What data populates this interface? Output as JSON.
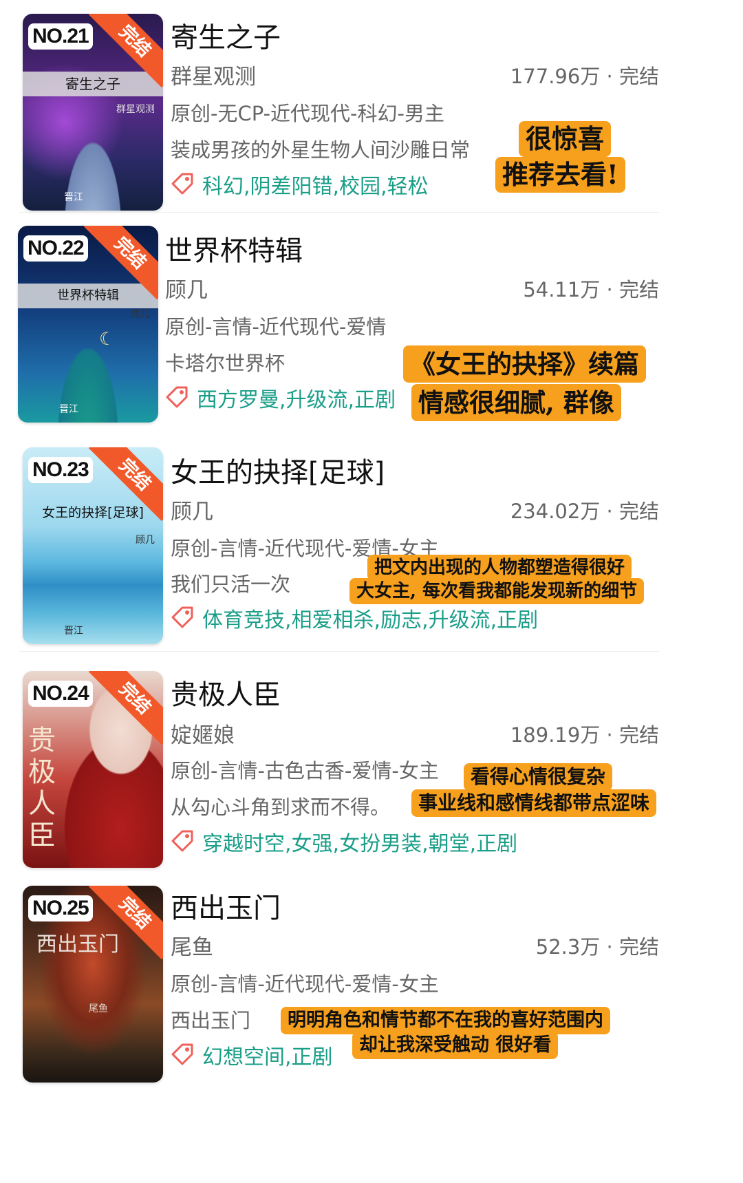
{
  "items": [
    {
      "rank": "NO.21",
      "status_ribbon": "完结",
      "cover_title": "寄生之子",
      "cover_author": "群星观测",
      "cover_logo": "晋江",
      "title": "寄生之子",
      "author": "群星观测",
      "stats": "177.96万 · 完结",
      "category": "原创-无CP-近代现代-科幻-男主",
      "summary": "装成男孩的外星生物人间沙雕日常",
      "tags": "科幻,阴差阳错,校园,轻松",
      "notes": [
        "很惊喜",
        "推荐去看!"
      ]
    },
    {
      "rank": "NO.22",
      "status_ribbon": "完结",
      "cover_title": "世界杯特辑",
      "cover_author": "顾几",
      "cover_logo": "晋江",
      "title": "世界杯特辑",
      "author": "顾几",
      "stats": "54.11万 · 完结",
      "category": "原创-言情-近代现代-爱情",
      "summary": "卡塔尔世界杯",
      "tags": "西方罗曼,升级流,正剧",
      "notes": [
        "《女王的抉择》续篇",
        "情感很细腻, 群像"
      ]
    },
    {
      "rank": "NO.23",
      "status_ribbon": "完结",
      "cover_title": "女王的抉择[足球]",
      "cover_author": "顾几",
      "cover_logo": "晋江",
      "title": "女王的抉择[足球]",
      "author": "顾几",
      "stats": "234.02万 · 完结",
      "category": "原创-言情-近代现代-爱情-女主",
      "summary": "我们只活一次",
      "tags": "体育竞技,相爱相杀,励志,升级流,正剧",
      "notes": [
        "把文内出现的人物都塑造得很好",
        "大女主, 每次看我都能发现新的细节"
      ]
    },
    {
      "rank": "NO.24",
      "status_ribbon": "完结",
      "cover_title": "贵极人臣",
      "cover_author": "",
      "cover_logo": "",
      "title": "贵极人臣",
      "author": "婝嫟娘",
      "stats": "189.19万 · 完结",
      "category": "原创-言情-古色古香-爱情-女主",
      "summary": "从勾心斗角到求而不得。",
      "tags": "穿越时空,女强,女扮男装,朝堂,正剧",
      "notes": [
        "看得心情很复杂",
        "事业线和感情线都带点涩味"
      ]
    },
    {
      "rank": "NO.25",
      "status_ribbon": "完结",
      "cover_title": "西出玉门",
      "cover_author": "尾鱼",
      "cover_logo": "",
      "title": "西出玉门",
      "author": "尾鱼",
      "stats": "52.3万 · 完结",
      "category": "原创-言情-近代现代-爱情-女主",
      "summary": "西出玉门",
      "tags": "幻想空间,正剧",
      "notes": [
        "明明角色和情节都不在我的喜好范围内",
        "却让我深受触动 很好看"
      ]
    }
  ]
}
